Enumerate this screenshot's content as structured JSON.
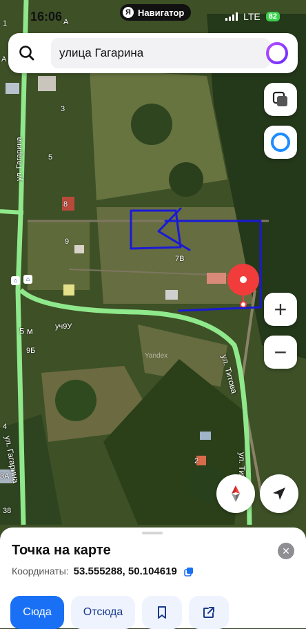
{
  "status_bar": {
    "time": "16:06",
    "app_badge": "Навигатор",
    "app_badge_logo": "Я",
    "network": "LTE",
    "battery": "82"
  },
  "search": {
    "query": "улица Гагарина",
    "icon": "search-icon",
    "assistant_icon": "alice-icon"
  },
  "map": {
    "street_labels": [
      "ул. Гагарина",
      "ул. Гагарина",
      "ул. Титова",
      "ул. Титова"
    ],
    "house_numbers": [
      "3",
      "5",
      "8",
      "9",
      "7В",
      "9Б",
      "уч9У",
      "2",
      "3А",
      "38",
      "4",
      "1",
      "А",
      "А"
    ],
    "watermark": "Yandex",
    "scale_text": "5 м"
  },
  "controls": {
    "layers_icon": "layers-icon",
    "alice_map_icon": "alice-map-icon",
    "zoom_in": "+",
    "zoom_out": "−",
    "compass_icon": "compass-icon",
    "locate_icon": "location-arrow-icon"
  },
  "sheet": {
    "title": "Точка на карте",
    "coords_label": "Координаты:",
    "coords_value": "53.555288, 50.104619",
    "buttons": {
      "to": "Сюда",
      "from": "Отсюда",
      "bookmark_icon": "bookmark-icon",
      "share_icon": "share-icon"
    }
  },
  "colors": {
    "road_green": "#8fe88b",
    "marker_red": "#f23c3c",
    "primary_blue": "#1a70f5",
    "drawing_blue": "#1a1ad6"
  }
}
